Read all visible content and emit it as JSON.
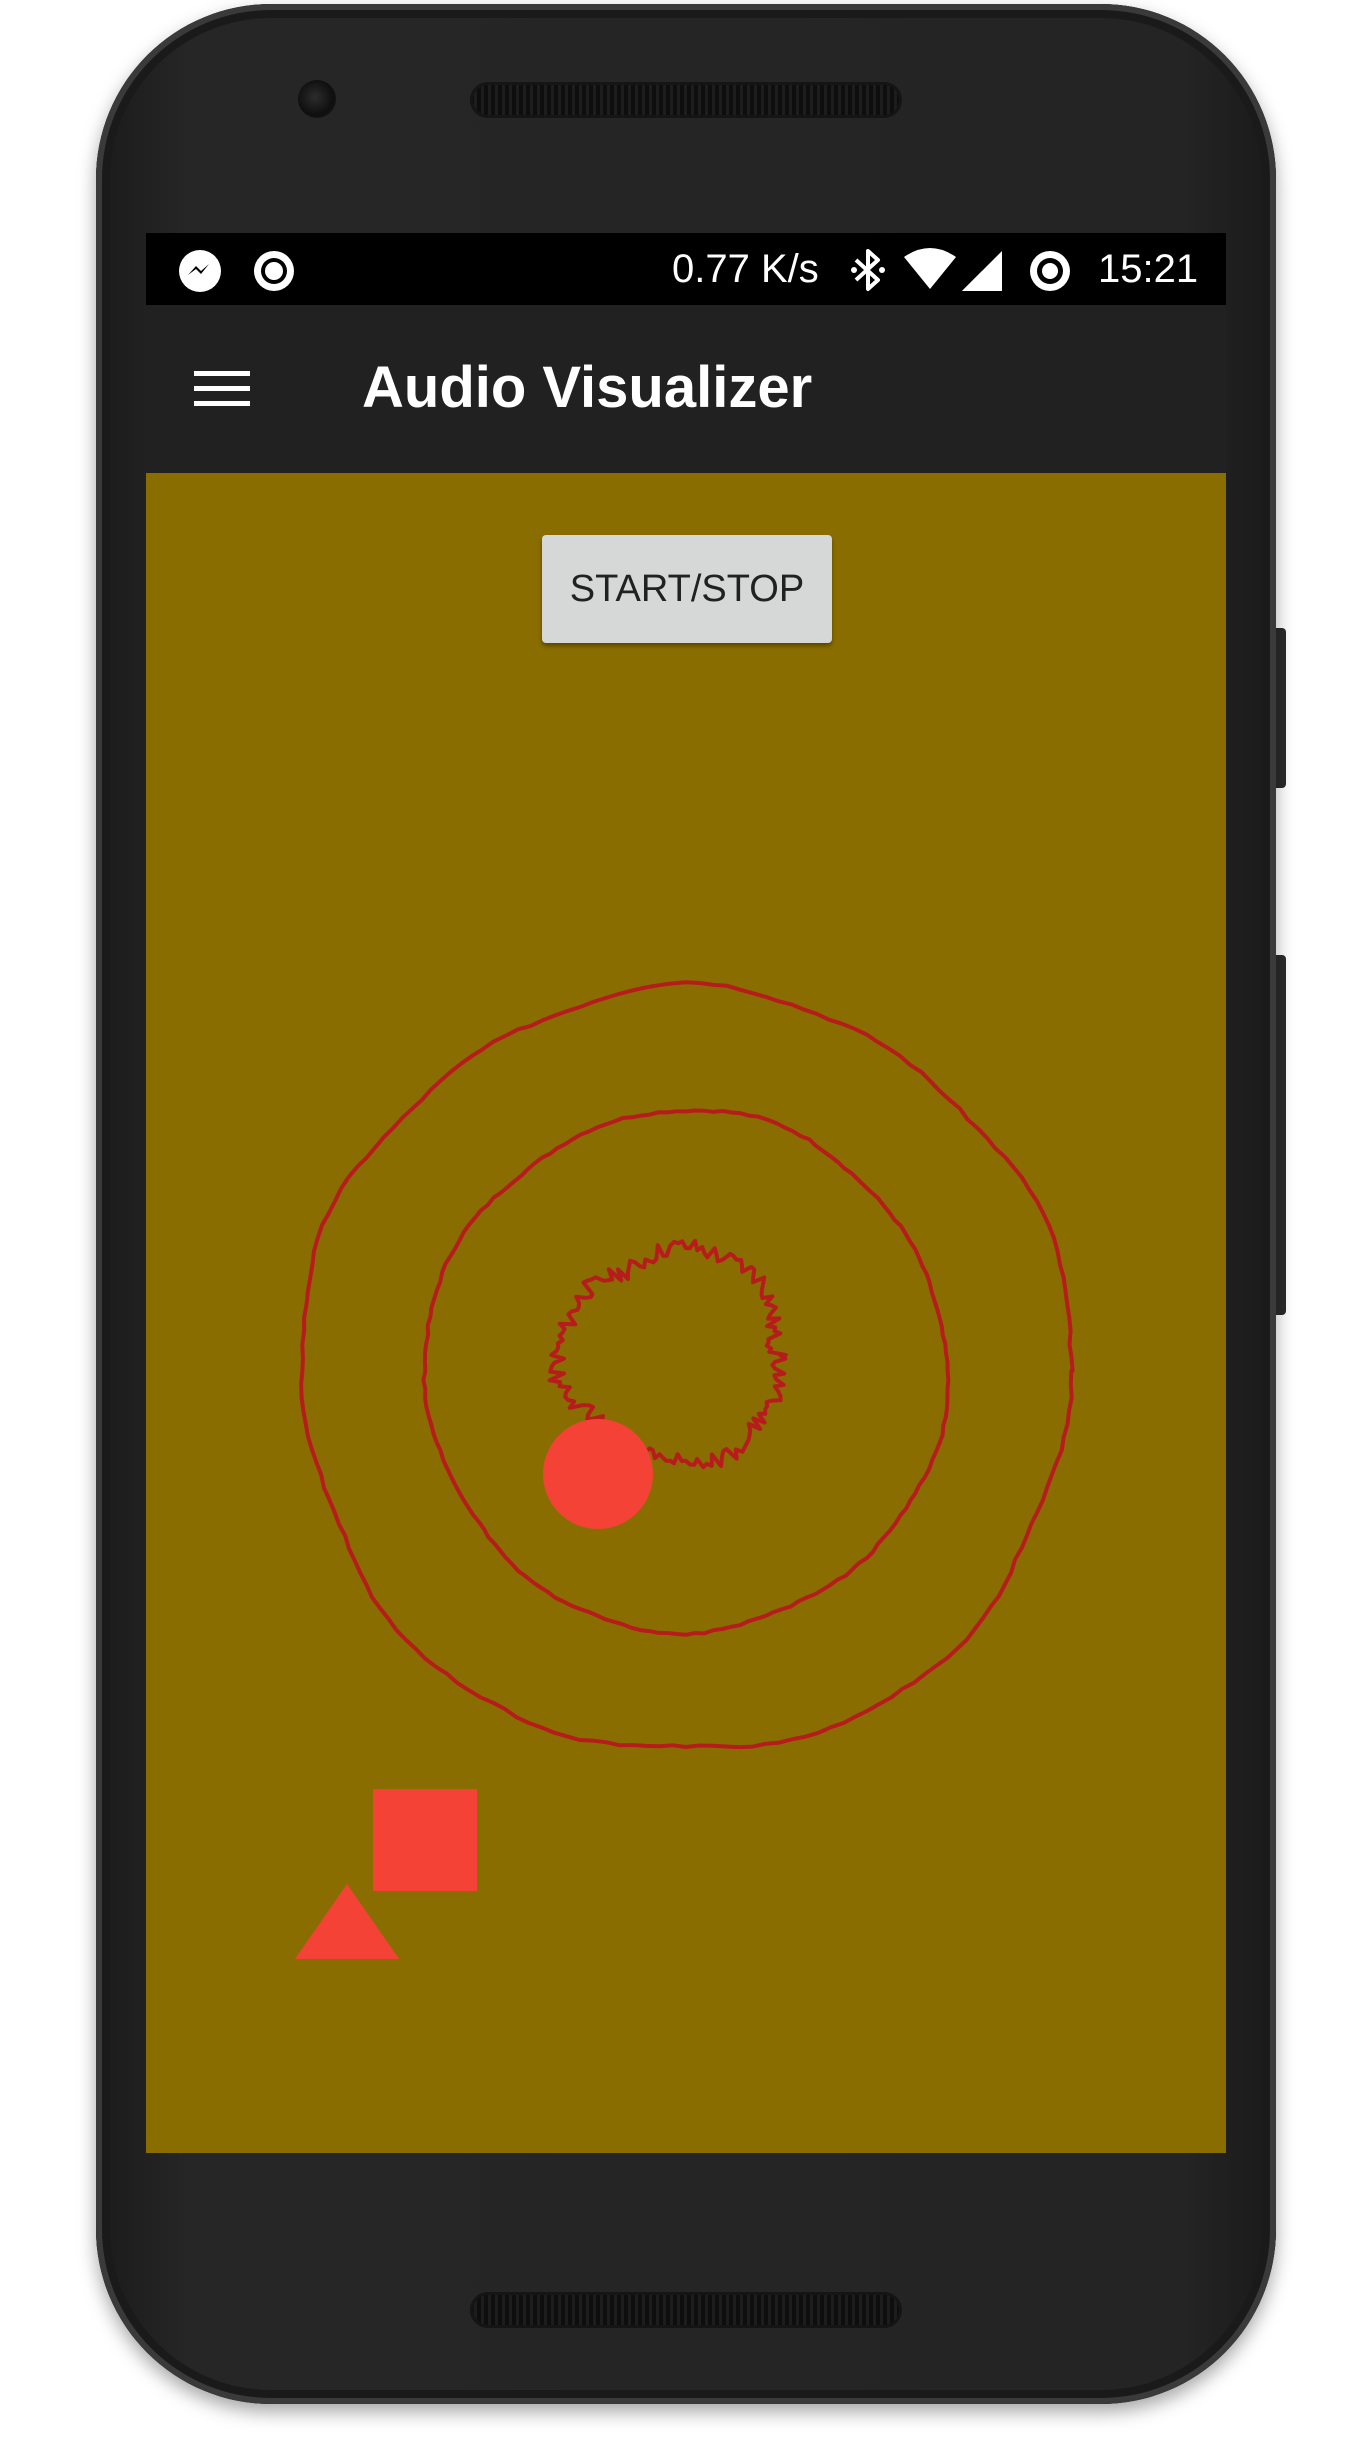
{
  "status_bar": {
    "left_icons": [
      "messenger-icon",
      "record-icon"
    ],
    "speed": "0.77 K/s",
    "right_icons": [
      "bluetooth-icon",
      "wifi-icon",
      "signal-icon",
      "record-icon"
    ],
    "time": "15:21"
  },
  "toolbar": {
    "menu_icon": "hamburger-menu-icon",
    "title": "Audio Visualizer"
  },
  "main": {
    "start_stop_label": "START/STOP"
  },
  "colors": {
    "screen_background": "#8a6d00",
    "toolbar_background": "#212121",
    "status_bar_background": "#000000",
    "waveform_stroke": "#b71c1c",
    "shape_fill": "#f44336",
    "button_background": "#d6d7d7"
  },
  "visualizer": {
    "shapes": [
      "circle",
      "square",
      "triangle"
    ],
    "waveform_rings": 3
  }
}
